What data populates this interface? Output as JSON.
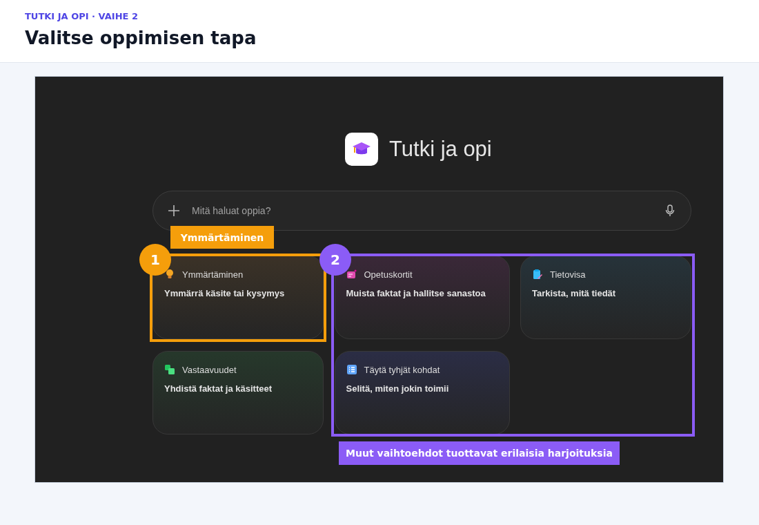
{
  "header": {
    "eyebrow": "TUTKI JA OPI · VAIHE 2",
    "title": "Valitse oppimisen tapa"
  },
  "app": {
    "title": "Tutki ja opi",
    "search": {
      "placeholder": "Mitä haluat oppia?"
    },
    "cards": [
      {
        "kind": "bulb",
        "title": "Ymmärtäminen",
        "description": "Ymmärrä käsite tai kysymys",
        "color": "#3b3227"
      },
      {
        "kind": "flashcards",
        "title": "Opetuskortit",
        "description": "Muista faktat ja hallitse sanastoa",
        "color": "#3a2838"
      },
      {
        "kind": "quiz",
        "title": "Tietovisa",
        "description": "Tarkista, mitä tiedät",
        "color": "#26333a"
      },
      {
        "kind": "match",
        "title": "Vastaavuudet",
        "description": "Yhdistä faktat ja käsitteet",
        "color": "#26382b"
      },
      {
        "kind": "fill",
        "title": "Täytä tyhjät kohdat",
        "description": "Selitä, miten jokin toimii",
        "color": "#2b2d45"
      }
    ]
  },
  "annotations": [
    {
      "kind": "first",
      "number": "1",
      "label": "Ymmärtäminen",
      "color": "#f59e0b"
    },
    {
      "kind": "rest",
      "number": "2",
      "label": "Muut vaihtoehdot tuottavat erilaisia harjoituksia",
      "color": "#8b5cf6"
    }
  ]
}
